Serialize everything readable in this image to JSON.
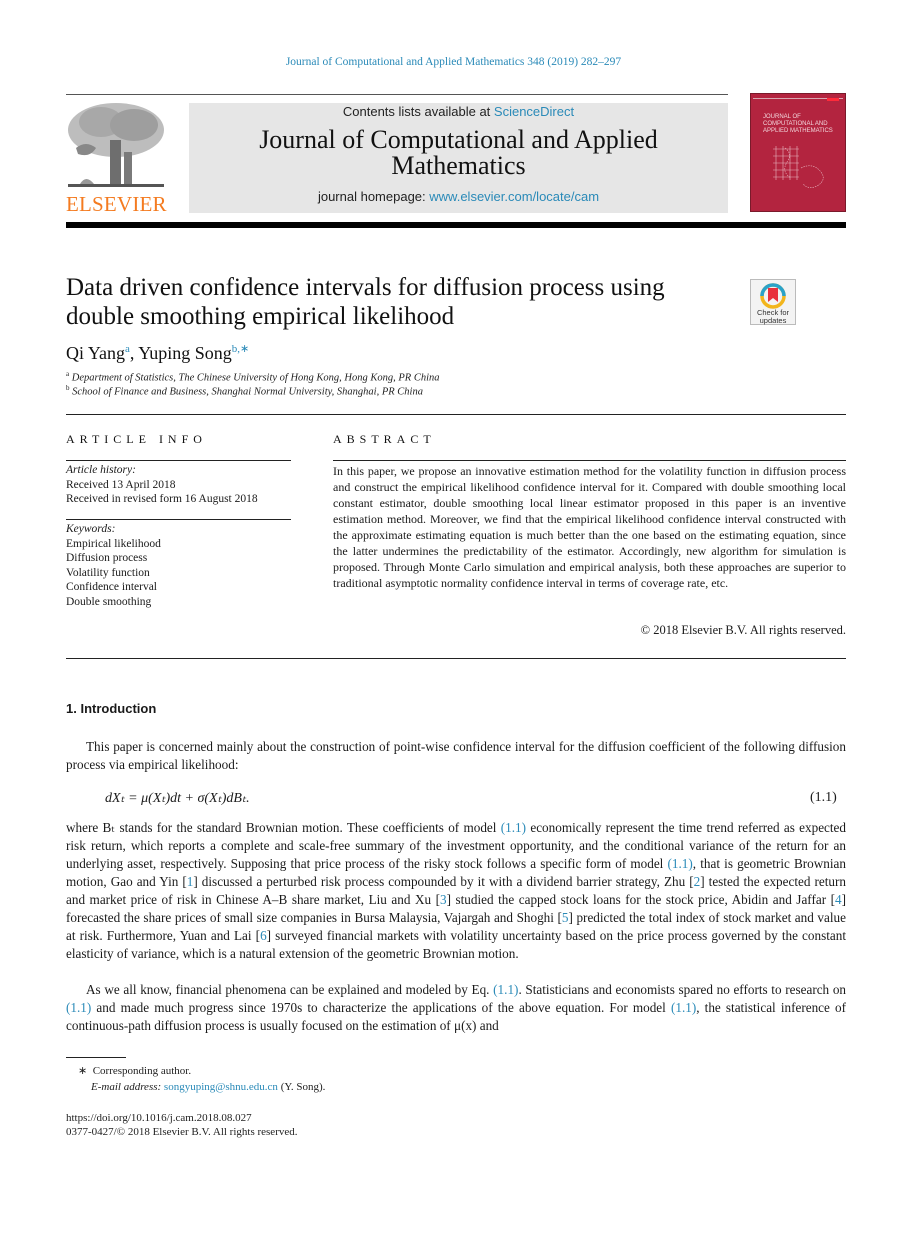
{
  "running_head": "Journal of Computational and Applied Mathematics 348 (2019) 282–297",
  "publisher": {
    "logo_icon": "elsevier-tree-logo",
    "name": "ELSEVIER"
  },
  "banner": {
    "contents_prefix": "Contents lists available at ",
    "contents_link": "ScienceDirect",
    "journal_title_line1": "Journal of Computational and Applied",
    "journal_title_line2": "Mathematics",
    "homepage_prefix": "journal homepage: ",
    "homepage_link": "www.elsevier.com/locate/cam"
  },
  "cover": {
    "title_lines": [
      "JOURNAL OF",
      "COMPUTATIONAL AND",
      "APPLIED MATHEMATICS"
    ],
    "color": "#b3243f"
  },
  "article": {
    "title_line1": "Data driven confidence intervals for diffusion process using",
    "title_line2": "double smoothing empirical likelihood",
    "crossmark_label_line1": "Check for",
    "crossmark_label_line2": "updates",
    "authors": [
      {
        "name": "Qi Yang",
        "sup": "a"
      },
      {
        "name": "Yuping Song",
        "sup": "b,∗"
      }
    ],
    "affiliations": [
      {
        "mark": "a",
        "text": "Department of Statistics, The Chinese University of Hong Kong, Hong Kong, PR China"
      },
      {
        "mark": "b",
        "text": "School of Finance and Business, Shanghai Normal University, Shanghai, PR China"
      }
    ]
  },
  "article_info": {
    "heading": "ARTICLE INFO",
    "history_label": "Article history:",
    "received": "Received 13 April 2018",
    "revised": "Received in revised form 16 August 2018",
    "keywords_label": "Keywords:",
    "keywords": [
      "Empirical likelihood",
      "Diffusion process",
      "Volatility function",
      "Confidence interval",
      "Double smoothing"
    ]
  },
  "abstract": {
    "heading": "ABSTRACT",
    "text": "In this paper, we propose an innovative estimation method for the volatility function in diffusion process and construct the empirical likelihood confidence interval for it. Compared with double smoothing local constant estimator, double smoothing local linear estimator proposed in this paper is an inventive estimation method. Moreover, we find that the empirical likelihood confidence interval constructed with the approximate estimating equation is much better than the one based on the estimating equation, since the latter undermines the predictability of the estimator. Accordingly, new algorithm for simulation is proposed. Through Monte Carlo simulation and empirical analysis, both these approaches are superior to traditional asymptotic normality confidence interval in terms of coverage rate, etc.",
    "copyright": "© 2018 Elsevier B.V. All rights reserved."
  },
  "introduction": {
    "heading": "1.  Introduction",
    "para1": "This paper is concerned mainly about the construction of point-wise confidence interval for the diffusion coefficient of the following diffusion process via empirical likelihood:",
    "equation": "dXₜ = μ(Xₜ)dt + σ(Xₜ)dBₜ.",
    "equation_number": "(1.1)",
    "para2_parts": [
      {
        "t": "where Bₜ stands for the standard Brownian motion. These coefficients of model "
      },
      {
        "t": "(1.1)",
        "link": true
      },
      {
        "t": " economically represent the time trend referred as expected risk return, which reports a complete and scale-free summary of the investment opportunity, and the conditional variance of the return for an underlying asset, respectively. Supposing that price process of the risky stock follows a specific form of model "
      },
      {
        "t": "(1.1)",
        "link": true
      },
      {
        "t": ", that is geometric Brownian motion, Gao and Yin ["
      },
      {
        "t": "1",
        "link": true
      },
      {
        "t": "] discussed a perturbed risk process compounded by it with a dividend barrier strategy, Zhu ["
      },
      {
        "t": "2",
        "link": true
      },
      {
        "t": "] tested the expected return and market price of risk in Chinese A–B share market, Liu and Xu ["
      },
      {
        "t": "3",
        "link": true
      },
      {
        "t": "] studied the capped stock loans for the stock price, Abidin and Jaffar ["
      },
      {
        "t": "4",
        "link": true
      },
      {
        "t": "] forecasted the share prices of small size companies in Bursa Malaysia, Vajargah and Shoghi ["
      },
      {
        "t": "5",
        "link": true
      },
      {
        "t": "] predicted the total index of stock market and value at risk. Furthermore, Yuan and Lai ["
      },
      {
        "t": "6",
        "link": true
      },
      {
        "t": "] surveyed financial markets with volatility uncertainty based on the price process governed by the constant elasticity of variance, which is a natural extension of the geometric Brownian motion."
      }
    ],
    "para3_parts": [
      {
        "t": "As we all know, financial phenomena can be explained and modeled by Eq. "
      },
      {
        "t": "(1.1)",
        "link": true
      },
      {
        "t": ". Statisticians and economists spared no efforts to research on "
      },
      {
        "t": "(1.1)",
        "link": true
      },
      {
        "t": " and made much progress since 1970s to characterize the applications of the above equation. For model "
      },
      {
        "t": "(1.1)",
        "link": true
      },
      {
        "t": ", the statistical inference of continuous-path diffusion process is usually focused on the estimation of μ(x) and"
      }
    ]
  },
  "footnotes": {
    "star": "∗",
    "corresponding": "Corresponding author.",
    "email_label": "E-mail address: ",
    "email": "songyuping@shnu.edu.cn",
    "email_suffix": " (Y. Song).",
    "doi": "https://doi.org/10.1016/j.cam.2018.08.027",
    "issn_line": "0377-0427/© 2018 Elsevier B.V. All rights reserved."
  },
  "colors": {
    "link": "#2a8ab8",
    "elsevier_orange": "#f47b20",
    "banner_bg": "#e6e6e6"
  }
}
